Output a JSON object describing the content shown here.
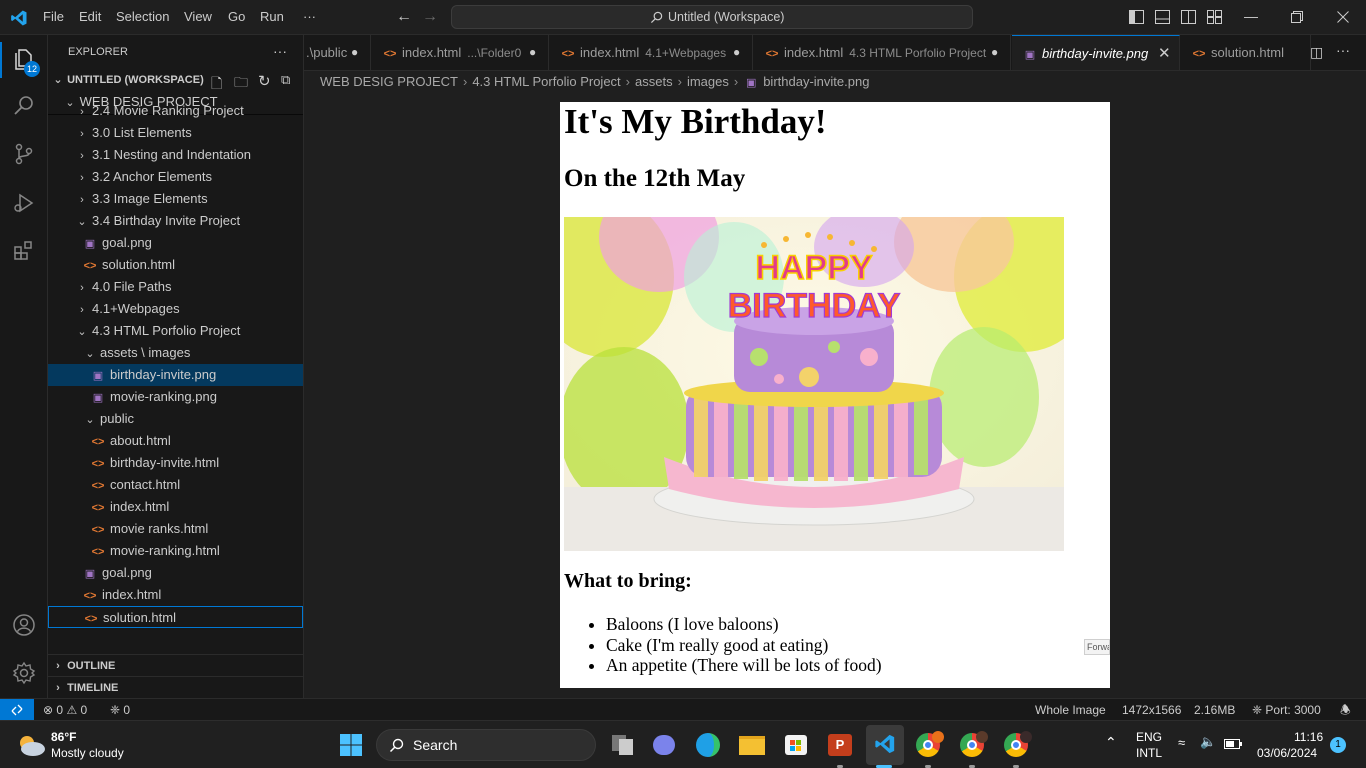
{
  "menu": {
    "file": "File",
    "edit": "Edit",
    "selection": "Selection",
    "view": "View",
    "go": "Go",
    "run": "Run",
    "more": "···"
  },
  "command_center": {
    "label": "Untitled (Workspace)"
  },
  "activity": {
    "explorer_badge": "12"
  },
  "sidebar": {
    "header": "EXPLORER",
    "more": "···",
    "workspace": "UNTITLED (WORKSPACE)",
    "project": "WEB DESIG PROJECT",
    "tree": [
      {
        "label": "2.4 Movie Ranking Project",
        "kind": "folder",
        "expanded": false,
        "depth": 1
      },
      {
        "label": "3.0 List Elements",
        "kind": "folder",
        "expanded": false,
        "depth": 1
      },
      {
        "label": "3.1 Nesting and Indentation",
        "kind": "folder",
        "expanded": false,
        "depth": 1
      },
      {
        "label": "3.2 Anchor Elements",
        "kind": "folder",
        "expanded": false,
        "depth": 1
      },
      {
        "label": "3.3 Image Elements",
        "kind": "folder",
        "expanded": false,
        "depth": 1
      },
      {
        "label": "3.4 Birthday Invite Project",
        "kind": "folder",
        "expanded": true,
        "depth": 1
      },
      {
        "label": "goal.png",
        "kind": "image",
        "depth": 2
      },
      {
        "label": "solution.html",
        "kind": "html",
        "depth": 2
      },
      {
        "label": "4.0 File Paths",
        "kind": "folder",
        "expanded": false,
        "depth": 1
      },
      {
        "label": "4.1+Webpages",
        "kind": "folder",
        "expanded": false,
        "depth": 1
      },
      {
        "label": "4.3 HTML Porfolio Project",
        "kind": "folder",
        "expanded": true,
        "depth": 1
      },
      {
        "label": "assets \\ images",
        "kind": "folder",
        "expanded": true,
        "depth": 2
      },
      {
        "label": "birthday-invite.png",
        "kind": "image",
        "depth": 3,
        "selected": true
      },
      {
        "label": "movie-ranking.png",
        "kind": "image",
        "depth": 3
      },
      {
        "label": "public",
        "kind": "folder",
        "expanded": true,
        "depth": 2
      },
      {
        "label": "about.html",
        "kind": "html",
        "depth": 3
      },
      {
        "label": "birthday-invite.html",
        "kind": "html",
        "depth": 3
      },
      {
        "label": "contact.html",
        "kind": "html",
        "depth": 3
      },
      {
        "label": "index.html",
        "kind": "html",
        "depth": 3
      },
      {
        "label": "movie ranks.html",
        "kind": "html",
        "depth": 3
      },
      {
        "label": "movie-ranking.html",
        "kind": "html",
        "depth": 3
      },
      {
        "label": "goal.png",
        "kind": "image",
        "depth": 2
      },
      {
        "label": "index.html",
        "kind": "html",
        "depth": 2
      },
      {
        "label": "solution.html",
        "kind": "html",
        "depth": 2,
        "focused": true
      }
    ],
    "outline": "OUTLINE",
    "timeline": "TIMELINE"
  },
  "tabs": [
    {
      "label": ".\\public",
      "desc": "",
      "dirty": true
    },
    {
      "label": "index.html",
      "desc": "...\\Folder0",
      "dirty": true
    },
    {
      "label": "index.html",
      "desc": "4.1+Webpages",
      "dirty": true
    },
    {
      "label": "index.html",
      "desc": "4.3 HTML Porfolio Project",
      "dirty": true
    },
    {
      "label": "birthday-invite.png",
      "desc": "",
      "active": true
    },
    {
      "label": "solution.html",
      "desc": ""
    }
  ],
  "breadcrumb": [
    "WEB DESIG PROJECT",
    "4.3 HTML Porfolio Project",
    "assets",
    "images",
    "birthday-invite.png"
  ],
  "preview": {
    "h1": "It's My Birthday!",
    "h2": "On the 12th May",
    "cake_text_1": "HAPPY",
    "cake_text_2": "BIRTHDAY",
    "h3": "What to bring:",
    "items": [
      "Baloons (I love baloons)",
      "Cake (I'm really good at eating)",
      "An appetite (There will be lots of food)"
    ],
    "forward_tip": "Forwa"
  },
  "status": {
    "errors": "0",
    "warnings": "0",
    "ports": "0",
    "mode": "Whole Image",
    "dimensions": "1472x1566",
    "size": "2.16MB",
    "port": "Port: 3000"
  },
  "taskbar": {
    "temp": "86°F",
    "weather": "Mostly cloudy",
    "search": "Search",
    "lang1": "ENG",
    "lang2": "INTL",
    "time": "11:16",
    "date": "03/06/2024",
    "notif": "1",
    "ppt_letter": "P"
  },
  "colors": {
    "accent": "#0078d4",
    "selection": "#04395e",
    "html_icon": "#e37933",
    "image_icon": "#a074c4"
  }
}
